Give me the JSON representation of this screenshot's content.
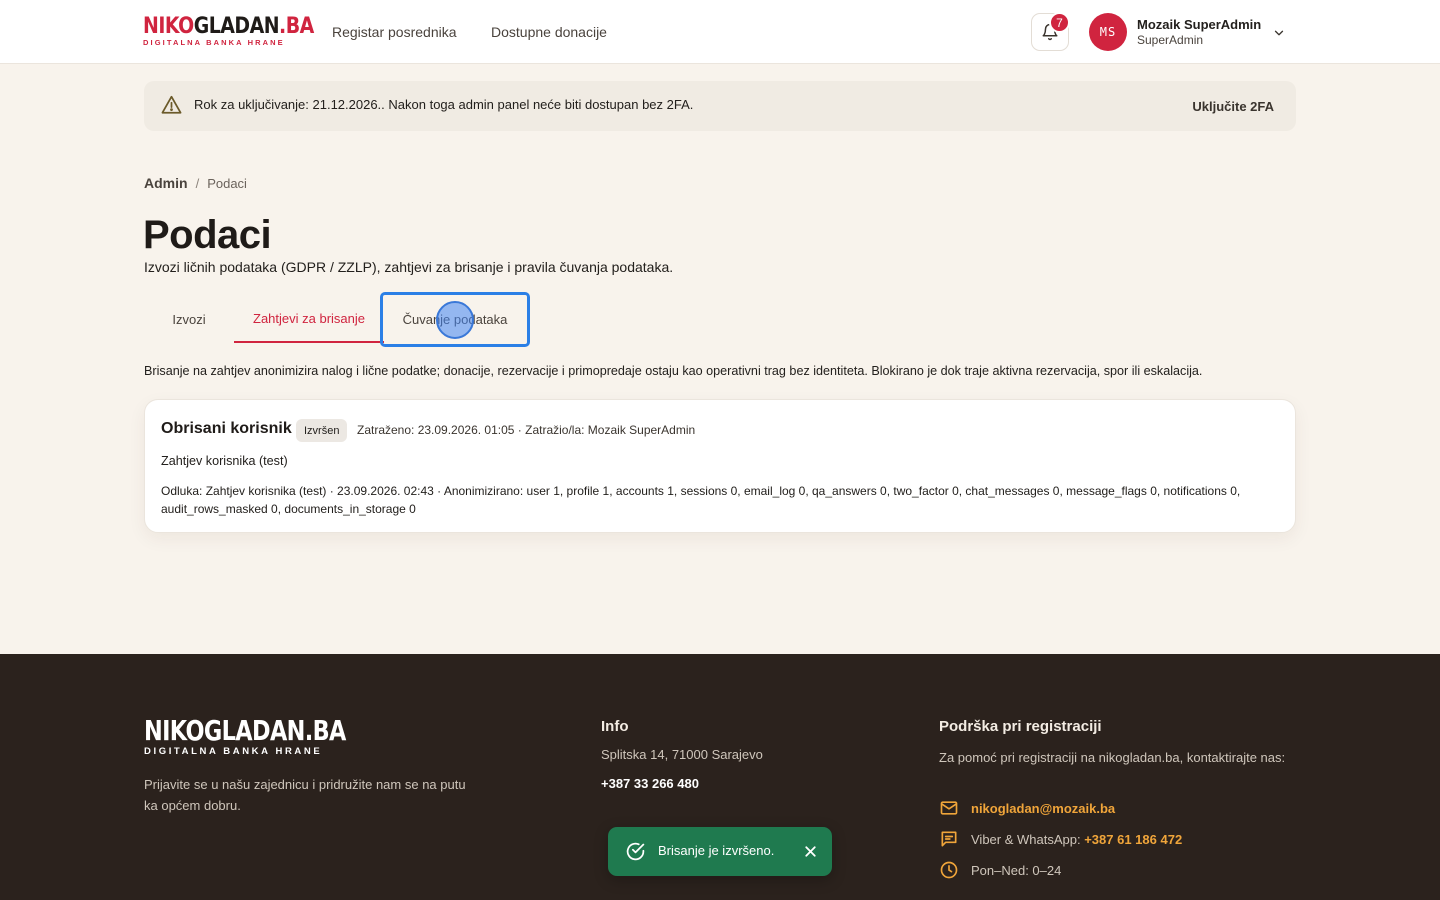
{
  "header": {
    "logo_main_red": "NIKO",
    "logo_main_dark": "GLADAN",
    "logo_main_red2": ".BA",
    "logo_sub": "DIGITALNA BANKA HRANE",
    "nav": [
      "Registar posrednika",
      "Dostupne donacije"
    ],
    "notifications_count": "7",
    "user": {
      "initials": "MS",
      "name": "Mozaik SuperAdmin",
      "role": "SuperAdmin"
    }
  },
  "alert": {
    "text": "Rok za uključivanje: 21.12.2026.. Nakon toga admin panel neće biti dostupan bez 2FA.",
    "button": "Uključite 2FA"
  },
  "breadcrumb": {
    "root": "Admin",
    "separator": "/",
    "current": "Podaci"
  },
  "page": {
    "title": "Podaci",
    "subtitle": "Izvozi ličnih podataka (GDPR / ZZLP), zahtjevi za brisanje i pravila čuvanja podataka."
  },
  "tabs": [
    {
      "label": "Izvozi",
      "active": false
    },
    {
      "label": "Zahtjevi za brisanje",
      "active": true
    },
    {
      "label": "Čuvanje podataka",
      "active": false
    }
  ],
  "description": "Brisanje na zahtjev anonimizira nalog i lične podatke; donacije, rezervacije i primopredaje ostaju kao operativni trag bez identiteta. Blokirano je dok traje aktivna rezervacija, spor ili eskalacija.",
  "request_card": {
    "title": "Obrisani korisnik",
    "status": "Izvršen",
    "meta": "Zatraženo: 23.09.2026. 01:05 · Zatražio/la: Mozaik SuperAdmin",
    "reason": "Zahtjev korisnika (test)",
    "decision": "Odluka: Zahtjev korisnika (test) · 23.09.2026. 02:43 · Anonimizirano: user 1, profile 1, accounts 1, sessions 0, email_log 0, qa_answers 0, two_factor 0, chat_messages 0, message_flags 0, notifications 0, audit_rows_masked 0, documents_in_storage 0"
  },
  "footer": {
    "logo_main": "NIKOGLADAN.BA",
    "logo_sub": "DIGITALNA BANKA HRANE",
    "tagline": "Prijavite se u našu zajednicu i pridružite nam se na putu ka općem dobru.",
    "info_title": "Info",
    "address": "Splitska 14, 71000 Sarajevo",
    "phone": "+387 33 266 480",
    "support_title": "Podrška pri registraciji",
    "support_text": "Za pomoć pri registraciji na nikogladan.ba, kontaktirajte nas:",
    "email": "nikogladan@mozaik.ba",
    "viber_label": "Viber & WhatsApp:",
    "viber_number": "+387 61 186 472",
    "hours": "Pon–Ned: 0–24"
  },
  "toast": {
    "text": "Brisanje je izvršeno."
  },
  "colors": {
    "brand_red": "#d0243f",
    "footer_bg": "#2b221d",
    "footer_accent": "#f0a53a",
    "toast_green": "#1f7a4f",
    "focus_blue": "#2b7fe6"
  }
}
